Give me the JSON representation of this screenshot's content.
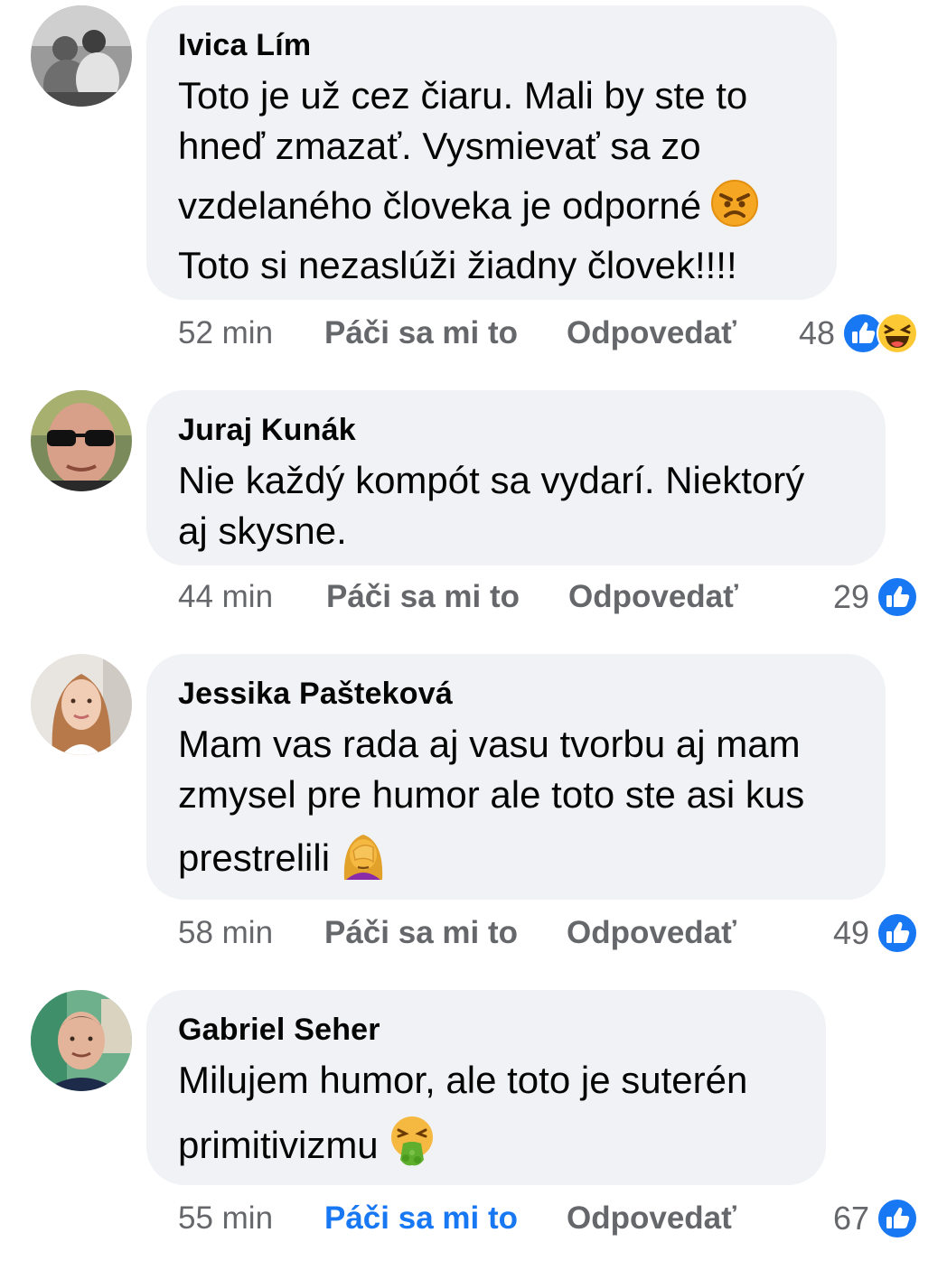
{
  "comments": [
    {
      "author": "Ivica Lím",
      "lines": [
        "Toto je už cez čiaru. Mali by ste to",
        "hneď zmazať. Vysmievať sa zo",
        "vzdelaného človeka je odporné",
        "Toto si nezaslúži žiadny človek!!!!"
      ],
      "emoji": "angry-face",
      "time": "52 min",
      "like_label": "Páči sa mi to",
      "like_active": false,
      "reply_label": "Odpovedať",
      "reaction_count": "48",
      "reactions": [
        "like",
        "haha"
      ]
    },
    {
      "author": "Juraj Kunák",
      "lines": [
        "Nie každý kompót sa vydarí. Niektorý",
        "aj skysne."
      ],
      "time": "44 min",
      "like_label": "Páči sa mi to",
      "like_active": false,
      "reply_label": "Odpovedať",
      "reaction_count": "29",
      "reactions": [
        "like"
      ]
    },
    {
      "author": "Jessika Pašteková",
      "lines": [
        "Mam vas rada aj vasu tvorbu aj mam",
        "zmysel pre humor ale toto ste asi kus",
        "prestrelili"
      ],
      "emoji": "facepalm",
      "time": "58 min",
      "like_label": "Páči sa mi to",
      "like_active": false,
      "reply_label": "Odpovedať",
      "reaction_count": "49",
      "reactions": [
        "like"
      ]
    },
    {
      "author": "Gabriel Seher",
      "lines": [
        "Milujem humor, ale toto je suterén",
        "primitivizmu"
      ],
      "emoji": "vomiting-face",
      "time": "55 min",
      "like_label": "Páči sa mi to",
      "like_active": true,
      "reply_label": "Odpovedať",
      "reaction_count": "67",
      "reactions": [
        "like"
      ]
    }
  ],
  "colors": {
    "bubble": "#f0f2f5",
    "meta_text": "#65676b",
    "like_blue": "#1877f2",
    "text": "#050505"
  }
}
